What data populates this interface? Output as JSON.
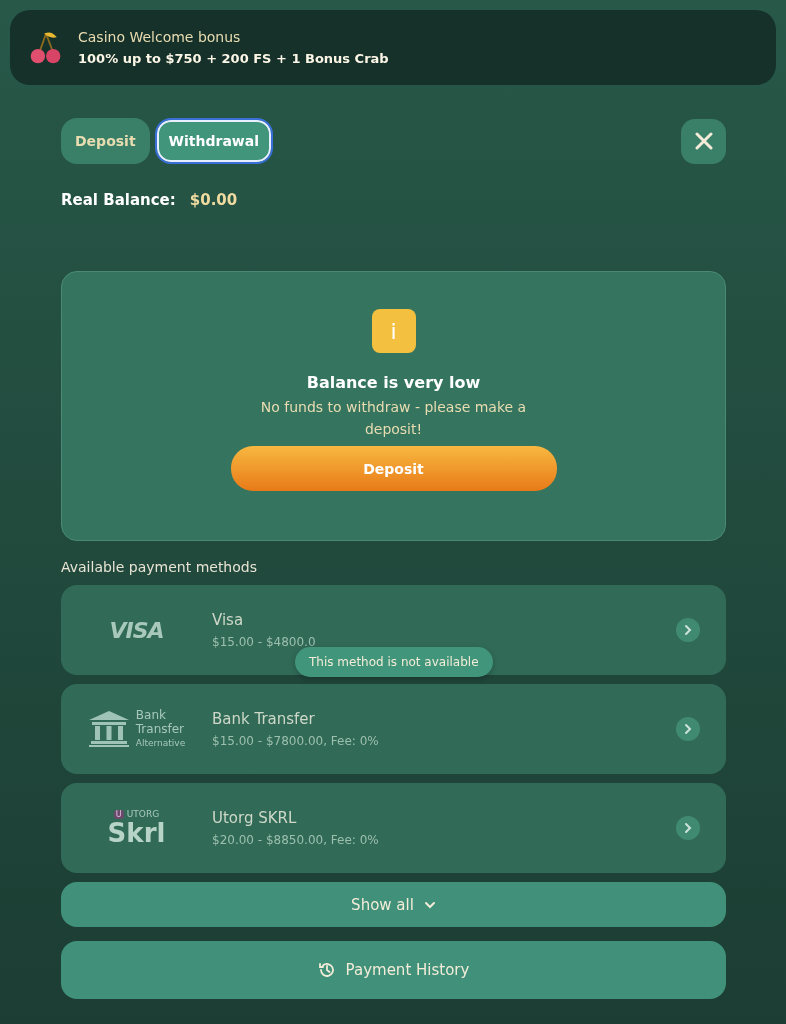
{
  "banner": {
    "title": "Casino Welcome bonus",
    "offer": "100% up to $750 + 200 FS + 1 Bonus Crab"
  },
  "tabs": [
    {
      "label": "Deposit",
      "selected": false
    },
    {
      "label": "Withdrawal",
      "selected": true
    }
  ],
  "balance": {
    "label": "Real Balance:",
    "value": "$0.00"
  },
  "notice": {
    "icon": "i",
    "title": "Balance is very low",
    "message": "No funds to withdraw - please make a deposit!",
    "button": "Deposit"
  },
  "methods_heading": "Available payment methods",
  "methods": [
    {
      "kind": "visa",
      "logo": [
        "VISA"
      ],
      "name": "Visa",
      "limits": "$15.00 - $4800.0",
      "tooltip": "This method is not available"
    },
    {
      "kind": "bank",
      "logo": [
        "Bank",
        "Transfer",
        "Alternative"
      ],
      "name": "Bank Transfer",
      "limits": "$15.00 - $7800.00, Fee: 0%"
    },
    {
      "kind": "skrl",
      "logo": [
        "U",
        "UTORG",
        "Skrl"
      ],
      "name": "Utorg SKRL",
      "limits": "$20.00 - $8850.00, Fee: 0%"
    }
  ],
  "show_all": "Show all",
  "history": "Payment History"
}
